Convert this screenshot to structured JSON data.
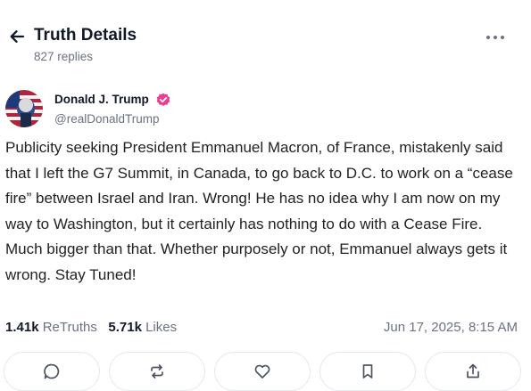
{
  "header": {
    "title": "Truth Details",
    "replies": "827 replies"
  },
  "post": {
    "author_name": "Donald J. Trump",
    "handle": "@realDonaldTrump",
    "text": "Publicity seeking President Emmanuel Macron, of France, mistakenly said that I left the G7 Summit, in Canada, to go back to D.C. to work on a “cease fire” between Israel and Iran. Wrong! He has no idea why I am now on my way to Washington, but it certainly has nothing to do with a Cease Fire. Much bigger than that. Whether purposely or not, Emmanuel always gets it wrong. Stay Tuned!",
    "retruths_count": "1.41k",
    "retruths_label": "ReTruths",
    "likes_count": "5.71k",
    "likes_label": "Likes",
    "timestamp": "Jun 17, 2025, 8:15 AM"
  },
  "icons": {
    "back": "arrow-left-icon",
    "more": "more-horizontal-icon",
    "verified": "verified-badge-icon",
    "reply": "comment-icon",
    "retruth": "repost-icon",
    "like": "heart-icon",
    "bookmark": "bookmark-icon",
    "share": "share-icon"
  },
  "colors": {
    "verified": "#e9408f",
    "text_secondary": "#6b7280",
    "border": "#e5e7eb"
  }
}
